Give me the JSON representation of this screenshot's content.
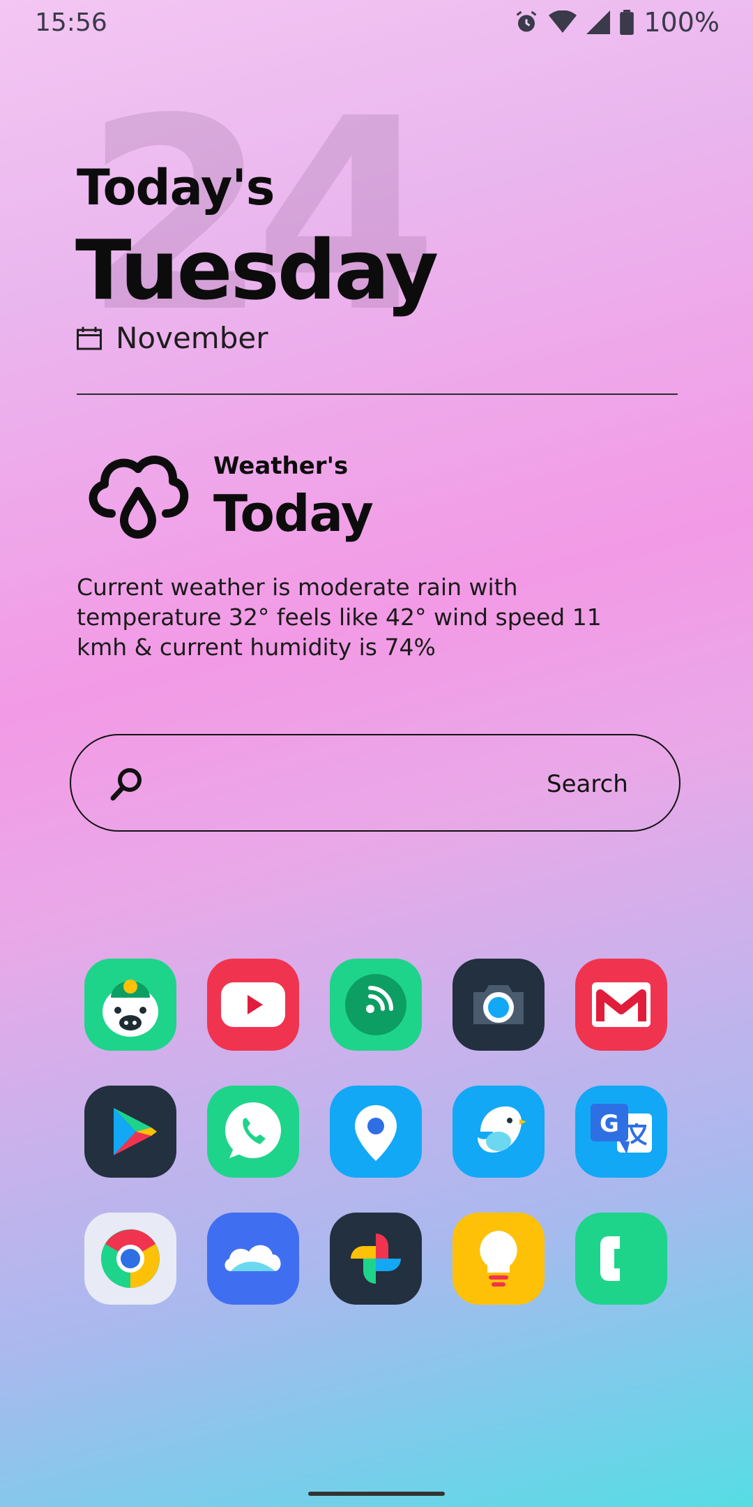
{
  "status_bar": {
    "time": "15:56",
    "battery": "100%",
    "icons": [
      "alarm-icon",
      "wifi-icon",
      "signal-icon",
      "battery-icon"
    ]
  },
  "date_widget": {
    "day_number": "24",
    "todays_label": "Today's",
    "weekday": "Tuesday",
    "month": "November"
  },
  "weather_widget": {
    "label": "Weather's",
    "title": "Today",
    "description": "Current weather is moderate rain with temperature 32° feels like 42° wind speed 11 kmh & current humidity is 74%"
  },
  "search": {
    "label": "Search"
  },
  "apps": [
    {
      "icon": "piggy-bank-app-icon",
      "color": "#1ed48b"
    },
    {
      "icon": "youtube-app-icon",
      "color": "#f0344f"
    },
    {
      "icon": "podcast-app-icon",
      "color": "#1ed48b"
    },
    {
      "icon": "camera-app-icon",
      "color": "#23303f"
    },
    {
      "icon": "gmail-app-icon",
      "color": "#f0344f"
    },
    {
      "icon": "play-store-app-icon",
      "color": "#23303f"
    },
    {
      "icon": "whatsapp-app-icon",
      "color": "#1ed48b"
    },
    {
      "icon": "maps-app-icon",
      "color": "#12a8f5"
    },
    {
      "icon": "bird-app-icon",
      "color": "#12a8f5"
    },
    {
      "icon": "translate-app-icon",
      "color": "#12a8f5"
    },
    {
      "icon": "chrome-app-icon",
      "color": "#e8eaf6"
    },
    {
      "icon": "cloud-app-icon",
      "color": "#3f6ef0"
    },
    {
      "icon": "photos-app-icon",
      "color": "#23303f"
    },
    {
      "icon": "lightbulb-app-icon",
      "color": "#ffc107"
    },
    {
      "icon": "phone-app-icon",
      "color": "#1ed48b"
    }
  ]
}
